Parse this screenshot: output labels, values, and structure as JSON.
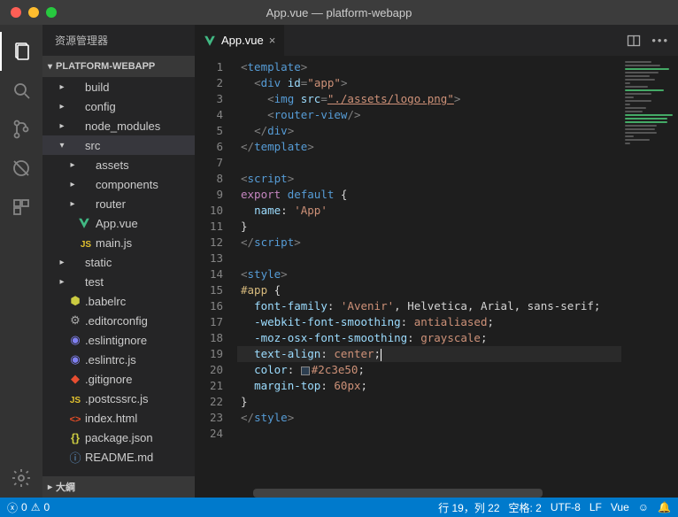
{
  "window": {
    "title": "App.vue — platform-webapp"
  },
  "sidebar": {
    "title": "资源管理器",
    "section_header": "PLATFORM-WEBAPP",
    "outline_header": "大綱",
    "items": [
      {
        "label": "build",
        "type": "folder",
        "indent": 1,
        "expanded": false
      },
      {
        "label": "config",
        "type": "folder",
        "indent": 1,
        "expanded": false
      },
      {
        "label": "node_modules",
        "type": "folder",
        "indent": 1,
        "expanded": false
      },
      {
        "label": "src",
        "type": "folder",
        "indent": 1,
        "expanded": true,
        "selected": true
      },
      {
        "label": "assets",
        "type": "folder",
        "indent": 2,
        "expanded": false
      },
      {
        "label": "components",
        "type": "folder",
        "indent": 2,
        "expanded": false
      },
      {
        "label": "router",
        "type": "folder",
        "indent": 2,
        "expanded": false
      },
      {
        "label": "App.vue",
        "type": "file",
        "indent": 2,
        "icon": "vue",
        "color": "#41b883"
      },
      {
        "label": "main.js",
        "type": "file",
        "indent": 2,
        "icon": "js",
        "color": "#e2c12f"
      },
      {
        "label": "static",
        "type": "folder",
        "indent": 1,
        "expanded": false
      },
      {
        "label": "test",
        "type": "folder",
        "indent": 1,
        "expanded": false
      },
      {
        "label": ".babelrc",
        "type": "file",
        "indent": 1,
        "icon": "babel",
        "color": "#cbcb41"
      },
      {
        "label": ".editorconfig",
        "type": "file",
        "indent": 1,
        "icon": "gear",
        "color": "#aaa"
      },
      {
        "label": ".eslintignore",
        "type": "file",
        "indent": 1,
        "icon": "eslint",
        "color": "#8080f2"
      },
      {
        "label": ".eslintrc.js",
        "type": "file",
        "indent": 1,
        "icon": "eslint",
        "color": "#8080f2"
      },
      {
        "label": ".gitignore",
        "type": "file",
        "indent": 1,
        "icon": "git",
        "color": "#e84e31"
      },
      {
        "label": ".postcssrc.js",
        "type": "file",
        "indent": 1,
        "icon": "js",
        "color": "#e2c12f"
      },
      {
        "label": "index.html",
        "type": "file",
        "indent": 1,
        "icon": "html",
        "color": "#e44d26"
      },
      {
        "label": "package.json",
        "type": "file",
        "indent": 1,
        "icon": "json",
        "color": "#cbcb41"
      },
      {
        "label": "README.md",
        "type": "file",
        "indent": 1,
        "icon": "info",
        "color": "#6196cc"
      }
    ]
  },
  "tab": {
    "label": "App.vue",
    "icon_color": "#41b883"
  },
  "editor": {
    "line_count": 24,
    "highlighted_line": 19,
    "lines": [
      "<template>",
      "  <div id=\"app\">",
      "    <img src=\"./assets/logo.png\">",
      "    <router-view/>",
      "  </div>",
      "</template>",
      "",
      "<script>",
      "export default {",
      "  name: 'App'",
      "}",
      "</script>",
      "",
      "<style>",
      "#app {",
      "  font-family: 'Avenir', Helvetica, Arial, sans-serif;",
      "  -webkit-font-smoothing: antialiased;",
      "  -moz-osx-font-smoothing: grayscale;",
      "  text-align: center;",
      "  color: #2c3e50;",
      "  margin-top: 60px;",
      "}",
      "</style>",
      ""
    ]
  },
  "status": {
    "errors": "0",
    "warnings": "0",
    "cursor": "行 19，列 22",
    "spaces": "空格: 2",
    "encoding": "UTF-8",
    "eol": "LF",
    "language": "Vue"
  }
}
